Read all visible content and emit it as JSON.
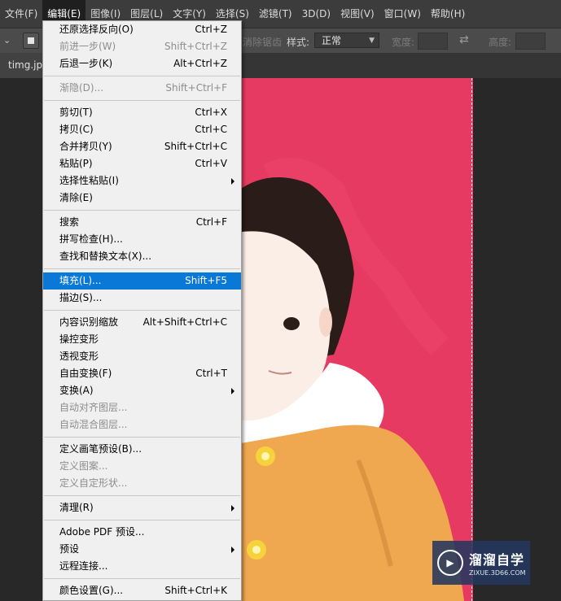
{
  "menubar": {
    "items": [
      "文件(F)",
      "编辑(E)",
      "图像(I)",
      "图层(L)",
      "文字(Y)",
      "选择(S)",
      "滤镜(T)",
      "3D(D)",
      "视图(V)",
      "窗口(W)",
      "帮助(H)"
    ]
  },
  "options": {
    "faded_label": "消除锯齿",
    "style_label": "样式:",
    "style_value": "正常",
    "width_label": "宽度:",
    "height_label": "高度:"
  },
  "tab": {
    "filename": "timg.jpg"
  },
  "edit_menu": {
    "groups": [
      [
        {
          "label": "还原选择反向(O)",
          "shortcut": "Ctrl+Z"
        },
        {
          "label": "前进一步(W)",
          "shortcut": "Shift+Ctrl+Z",
          "disabled": true
        },
        {
          "label": "后退一步(K)",
          "shortcut": "Alt+Ctrl+Z"
        }
      ],
      [
        {
          "label": "渐隐(D)...",
          "shortcut": "Shift+Ctrl+F",
          "disabled": true
        }
      ],
      [
        {
          "label": "剪切(T)",
          "shortcut": "Ctrl+X"
        },
        {
          "label": "拷贝(C)",
          "shortcut": "Ctrl+C"
        },
        {
          "label": "合并拷贝(Y)",
          "shortcut": "Shift+Ctrl+C"
        },
        {
          "label": "粘贴(P)",
          "shortcut": "Ctrl+V"
        },
        {
          "label": "选择性粘贴(I)",
          "shortcut": "",
          "submenu": true
        },
        {
          "label": "清除(E)",
          "shortcut": ""
        }
      ],
      [
        {
          "label": "搜索",
          "shortcut": "Ctrl+F"
        },
        {
          "label": "拼写检查(H)...",
          "shortcut": ""
        },
        {
          "label": "查找和替换文本(X)...",
          "shortcut": ""
        }
      ],
      [
        {
          "label": "填充(L)...",
          "shortcut": "Shift+F5",
          "highlighted": true
        },
        {
          "label": "描边(S)...",
          "shortcut": ""
        }
      ],
      [
        {
          "label": "内容识别缩放",
          "shortcut": "Alt+Shift+Ctrl+C"
        },
        {
          "label": "操控变形",
          "shortcut": ""
        },
        {
          "label": "透视变形",
          "shortcut": ""
        },
        {
          "label": "自由变换(F)",
          "shortcut": "Ctrl+T"
        },
        {
          "label": "变换(A)",
          "shortcut": "",
          "submenu": true
        },
        {
          "label": "自动对齐图层...",
          "shortcut": "",
          "disabled": true
        },
        {
          "label": "自动混合图层...",
          "shortcut": "",
          "disabled": true
        }
      ],
      [
        {
          "label": "定义画笔预设(B)...",
          "shortcut": ""
        },
        {
          "label": "定义图案...",
          "shortcut": "",
          "disabled": true
        },
        {
          "label": "定义自定形状...",
          "shortcut": "",
          "disabled": true
        }
      ],
      [
        {
          "label": "清理(R)",
          "shortcut": "",
          "submenu": true
        }
      ],
      [
        {
          "label": "Adobe PDF 预设...",
          "shortcut": ""
        },
        {
          "label": "预设",
          "shortcut": "",
          "submenu": true
        },
        {
          "label": "远程连接...",
          "shortcut": ""
        }
      ],
      [
        {
          "label": "颜色设置(G)...",
          "shortcut": "Shift+Ctrl+K"
        }
      ]
    ]
  },
  "watermark": {
    "brand": "溜溜自学",
    "site": "ZIXUE.3D66.COM"
  },
  "colors": {
    "highlight": "#0a78d7",
    "photo_bg": "#e73a63",
    "coat": "#f0a850"
  }
}
